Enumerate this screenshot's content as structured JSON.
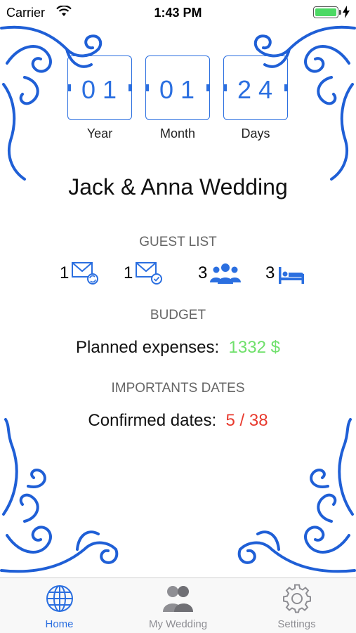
{
  "status_bar": {
    "carrier": "Carrier",
    "time": "1:43 PM",
    "battery_color": "#4cd964"
  },
  "countdown": [
    {
      "digits": "01",
      "label": "Year"
    },
    {
      "digits": "01",
      "label": "Month"
    },
    {
      "digits": "24",
      "label": "Days"
    }
  ],
  "title": "Jack & Anna Wedding",
  "guest_list": {
    "heading": "GUEST LIST",
    "items": [
      {
        "count": "1",
        "icon": "envelope-sync-icon"
      },
      {
        "count": "1",
        "icon": "envelope-check-icon"
      },
      {
        "count": "3",
        "icon": "group-icon"
      },
      {
        "count": "3",
        "icon": "bed-icon"
      }
    ]
  },
  "budget": {
    "heading": "BUDGET",
    "label": "Planned expenses:",
    "value": "1332 $",
    "value_color": "#6fe06b"
  },
  "dates": {
    "heading": "IMPORTANTS DATES",
    "label": "Confirmed dates:",
    "value": "5 / 38",
    "value_color": "#e83a2e"
  },
  "tabs": [
    {
      "label": "Home",
      "icon": "globe-icon",
      "active": true
    },
    {
      "label": "My Wedding",
      "icon": "couple-icon",
      "active": false
    },
    {
      "label": "Settings",
      "icon": "gear-icon",
      "active": false
    }
  ],
  "accent_color": "#2b6fe0"
}
